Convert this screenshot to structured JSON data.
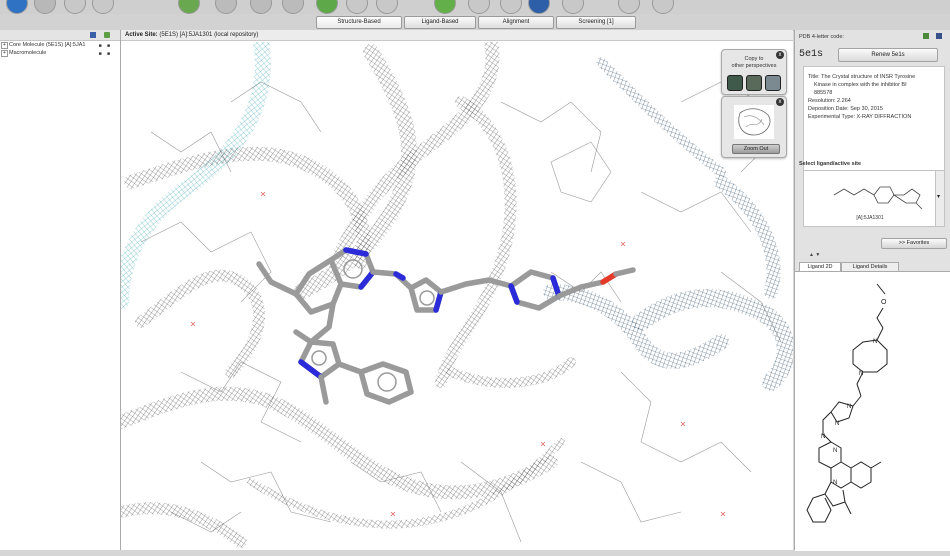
{
  "tabs": [
    "Structure-Based",
    "Ligand-Based",
    "Alignment",
    "Screening [1]"
  ],
  "left_panel": {
    "items": [
      {
        "label": "Core Molecule (5E1S) [A]:5JA1",
        "expander": "+"
      },
      {
        "label": "Macromolecule",
        "expander": "+"
      }
    ]
  },
  "viewport": {
    "label_prefix": "Active Site:",
    "site": "(5E1S) [A]:5JA1301",
    "source": "(local repository)"
  },
  "overlay": {
    "copy_title_1": "Copy to",
    "copy_title_2": "other perspectives",
    "zoom_out_label": "Zoom Out",
    "close_glyph": "x"
  },
  "pdb": {
    "code_label": "PDB 4-letter code:",
    "code_value": "5e1s",
    "renew_label": "Renew 5e1s",
    "title_line_1": "Title: The Crystal structure of INSR Tyrosine",
    "title_line_2": "Kinase in complex with the inhibitor BI",
    "title_line_3": "885578",
    "resolution": "Resolution: 2.264",
    "deposition_date": "Deposition Date: Sep 30, 2015",
    "experimental_type": "Experimental Type: X-RAY DIFFRACTION"
  },
  "ligand": {
    "select_label": "Select ligand/active site",
    "selected_name": "[A]:5JA1301",
    "favorites_label": ">> Favorites",
    "tab_2d": "Ligand 2D",
    "tab_details": "Ligand Details"
  },
  "colors": {
    "mesh_gray": "#555555",
    "mesh_navy": "#2f4f6b",
    "mesh_cyan": "#3aa7b5",
    "carbon": "#9a9a9a",
    "nitrogen": "#2b2bd9",
    "oxygen": "#e53a2a"
  }
}
